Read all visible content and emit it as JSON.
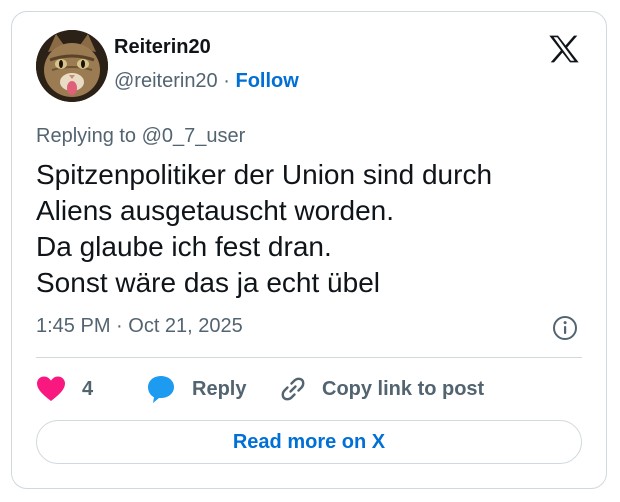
{
  "author": {
    "display_name": "Reiterin20",
    "handle": "@reiterin20",
    "separator": "·",
    "follow_label": "Follow"
  },
  "brand_logo": "x-logo-icon",
  "reply_context": "Replying to @0_7_user",
  "body_lines": [
    "Spitzenpolitiker der Union sind durch",
    "Aliens ausgetauscht worden.",
    "Da glaube ich fest dran.",
    "Sonst wäre das ja echt übel"
  ],
  "timestamp": "1:45 PM · Oct 21, 2025",
  "actions": {
    "like_count": "4",
    "reply_label": "Reply",
    "copy_link_label": "Copy link to post"
  },
  "read_more_label": "Read more on X",
  "colors": {
    "link_blue": "#006fd6",
    "like_pink": "#f91880",
    "reply_blue": "#1d9bf0",
    "secondary_text": "#536471",
    "border": "#cfd9de"
  }
}
